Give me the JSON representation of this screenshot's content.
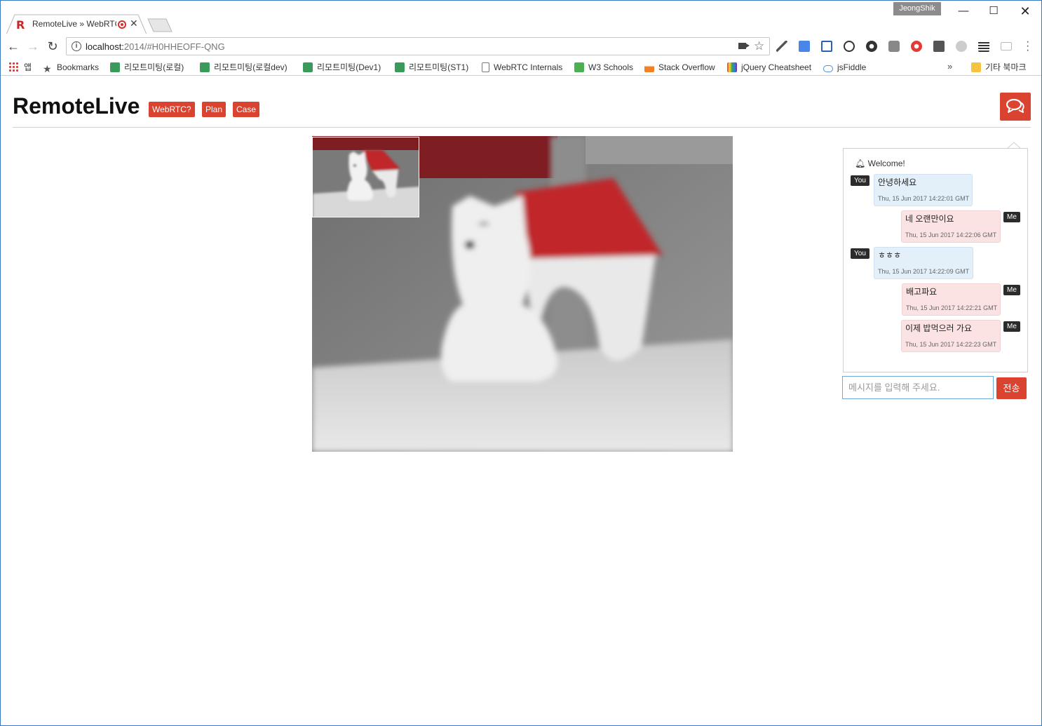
{
  "browser": {
    "profile_name": "JeongShik",
    "window_controls": {
      "minimize": "—",
      "maximize": "☐",
      "close": "✕"
    },
    "tab": {
      "title": "RemoteLive » WebRTC",
      "favicon": "R",
      "close": "✕"
    },
    "url_host": "localhost:",
    "url_rest": "2014/#H0HHEOFF-QNG",
    "info_glyph": "i",
    "star_glyph": "☆",
    "bookmarks": [
      {
        "label": "앱",
        "icon": "apps-grid-icon"
      },
      {
        "label": "Bookmarks",
        "icon": "star-icon"
      },
      {
        "label": "리모트미팅(로컬)",
        "icon": "remote-meeting-icon"
      },
      {
        "label": "리모트미팅(로컬dev)",
        "icon": "remote-meeting-icon"
      },
      {
        "label": "리모트미팅(Dev1)",
        "icon": "remote-meeting-icon"
      },
      {
        "label": "리모트미팅(ST1)",
        "icon": "remote-meeting-icon"
      },
      {
        "label": "WebRTC Internals",
        "icon": "page-icon"
      },
      {
        "label": "W3 Schools",
        "icon": "w3-icon"
      },
      {
        "label": "Stack Overflow",
        "icon": "stackoverflow-icon"
      },
      {
        "label": "jQuery Cheatsheet",
        "icon": "jquery-icon"
      },
      {
        "label": "jsFiddle",
        "icon": "jsfiddle-icon"
      }
    ],
    "more_bookmarks": "»",
    "other_bookmarks": "기타 북마크"
  },
  "app": {
    "brand": "RemoteLive",
    "nav": [
      "WebRTC?",
      "Plan",
      "Case"
    ]
  },
  "chat": {
    "welcome": "Welcome!",
    "messages": [
      {
        "sender": "You",
        "text": "안녕하세요",
        "time": "Thu, 15 Jun 2017 14:22:01 GMT"
      },
      {
        "sender": "Me",
        "text": "네 오랜만이요",
        "time": "Thu, 15 Jun 2017 14:22:06 GMT"
      },
      {
        "sender": "You",
        "text": "ㅎㅎㅎ",
        "time": "Thu, 15 Jun 2017 14:22:09 GMT"
      },
      {
        "sender": "Me",
        "text": "배고파요",
        "time": "Thu, 15 Jun 2017 14:22:21 GMT"
      },
      {
        "sender": "Me",
        "text": "이제 밥먹으러 가요",
        "time": "Thu, 15 Jun 2017 14:22:23 GMT"
      }
    ],
    "input_placeholder": "메시지를 입력해 주세요.",
    "send_label": "전송"
  },
  "colors": {
    "accent": "#d9432f",
    "you_bubble": "#e3eff9",
    "me_bubble": "#fbe3e3",
    "tag": "#2b2b2b"
  }
}
